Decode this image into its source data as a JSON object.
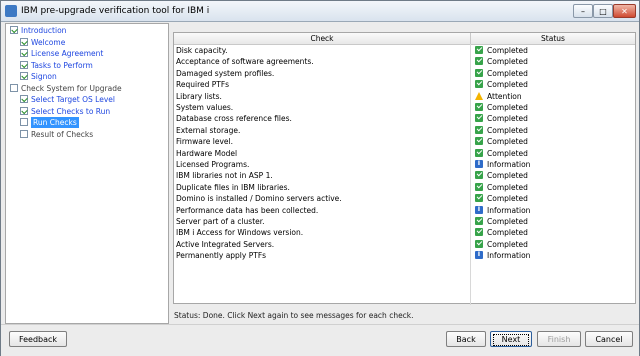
{
  "window": {
    "title": "IBM pre-upgrade verification tool for IBM i",
    "controls": {
      "minimize": "–",
      "maximize": "□",
      "close": "✕"
    }
  },
  "tree": [
    {
      "label": "Introduction",
      "checked": true,
      "indent": 0,
      "style": "blue"
    },
    {
      "label": "Welcome",
      "checked": true,
      "indent": 1,
      "style": "blue"
    },
    {
      "label": "License Agreement",
      "checked": true,
      "indent": 1,
      "style": "blue"
    },
    {
      "label": "Tasks to Perform",
      "checked": true,
      "indent": 1,
      "style": "blue"
    },
    {
      "label": "Signon",
      "checked": true,
      "indent": 1,
      "style": "blue"
    },
    {
      "label": "Check System for Upgrade",
      "checked": false,
      "indent": 0,
      "style": "gray"
    },
    {
      "label": "Select Target OS Level",
      "checked": true,
      "indent": 1,
      "style": "blue"
    },
    {
      "label": "Select Checks to Run",
      "checked": true,
      "indent": 1,
      "style": "blue"
    },
    {
      "label": "Run Checks",
      "checked": false,
      "indent": 1,
      "style": "sel"
    },
    {
      "label": "Result of Checks",
      "checked": false,
      "indent": 1,
      "style": "gray"
    }
  ],
  "table": {
    "headers": [
      "Check",
      "Status"
    ],
    "rows": [
      {
        "check": "Disk capacity.",
        "status": "Completed",
        "icon": "ok"
      },
      {
        "check": "Acceptance of software agreements.",
        "status": "Completed",
        "icon": "ok"
      },
      {
        "check": "Damaged system profiles.",
        "status": "Completed",
        "icon": "ok"
      },
      {
        "check": "Required PTFs",
        "status": "Completed",
        "icon": "ok"
      },
      {
        "check": "Library lists.",
        "status": "Attention",
        "icon": "warn"
      },
      {
        "check": "System values.",
        "status": "Completed",
        "icon": "ok"
      },
      {
        "check": "Database cross reference files.",
        "status": "Completed",
        "icon": "ok"
      },
      {
        "check": "External storage.",
        "status": "Completed",
        "icon": "ok"
      },
      {
        "check": "Firmware level.",
        "status": "Completed",
        "icon": "ok"
      },
      {
        "check": "Hardware Model",
        "status": "Completed",
        "icon": "ok"
      },
      {
        "check": "Licensed Programs.",
        "status": "Information",
        "icon": "info"
      },
      {
        "check": "IBM libraries not in ASP 1.",
        "status": "Completed",
        "icon": "ok"
      },
      {
        "check": "Duplicate files in IBM libraries.",
        "status": "Completed",
        "icon": "ok"
      },
      {
        "check": "Domino is installed / Domino servers active.",
        "status": "Completed",
        "icon": "ok"
      },
      {
        "check": "Performance data has been collected.",
        "status": "Information",
        "icon": "info"
      },
      {
        "check": "Server part of a cluster.",
        "status": "Completed",
        "icon": "ok"
      },
      {
        "check": "IBM i Access for Windows version.",
        "status": "Completed",
        "icon": "ok"
      },
      {
        "check": "Active Integrated Servers.",
        "status": "Completed",
        "icon": "ok"
      },
      {
        "check": "Permanently apply PTFs",
        "status": "Information",
        "icon": "info"
      }
    ]
  },
  "status_line": "Status: Done.  Click Next again to see messages for each check.",
  "buttons": {
    "feedback": "Feedback",
    "back": "Back",
    "next": "Next",
    "finish": "Finish",
    "cancel": "Cancel"
  }
}
